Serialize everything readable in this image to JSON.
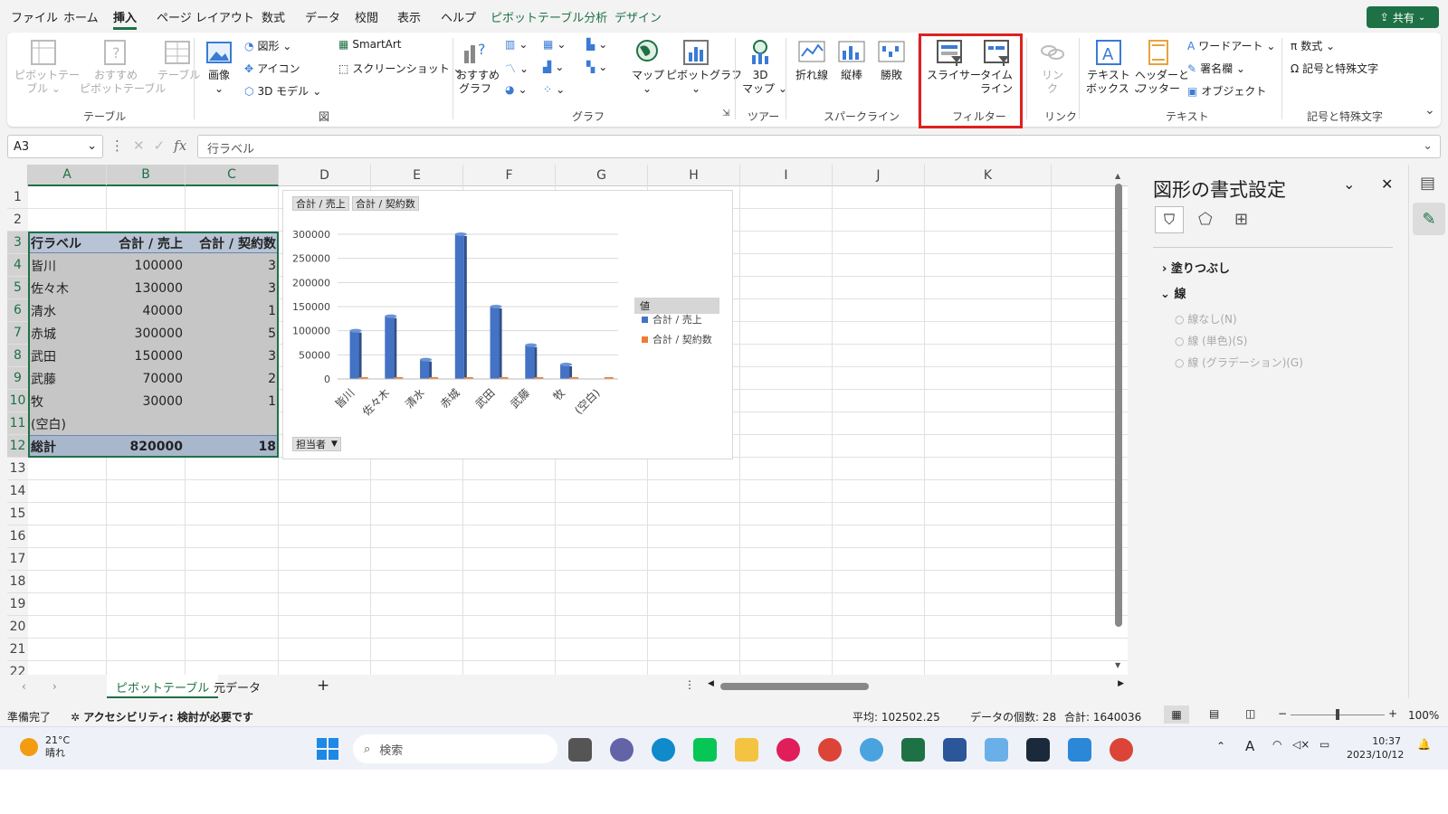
{
  "menu": {
    "tabs": [
      "ファイル",
      "ホーム",
      "挿入",
      "ページ レイアウト",
      "数式",
      "データ",
      "校閲",
      "表示",
      "ヘルプ",
      "ピボットテーブル分析",
      "デザイン"
    ],
    "share": "共有"
  },
  "ribbon": {
    "pivot": "ピボットテー\nブル ⌄",
    "recpivot": "おすすめ\nピボットテーブル",
    "table": "テーブル",
    "grp_table": "テーブル",
    "image": "画像",
    "shapes": "図形 ⌄",
    "icons": "アイコン",
    "model3d": "3D モデル",
    "smartart": "SmartArt",
    "screenshot": "スクリーンショット ⌄",
    "grp_fig": "図",
    "recchart": "おすすめ\nグラフ",
    "map": "マップ",
    "pivotchart": "ピボットグラフ",
    "grp_chart": "グラフ",
    "map3d": "3D\nマップ ⌄",
    "grp_tour": "ツアー",
    "line": "折れ線",
    "column": "縦棒",
    "winloss": "勝敗",
    "grp_spark": "スパークライン",
    "slicer": "スライサー",
    "timeline": "タイム\nライン",
    "grp_filter": "フィルター",
    "link": "リン\nク",
    "grp_link": "リンク",
    "textbox": "テキスト\nボックス ⌄",
    "headerfooter": "ヘッダーと\nフッター",
    "wordart": "ワードアート ⌄",
    "signature": "署名欄 ⌄",
    "object": "オブジェクト",
    "grp_text": "テキスト",
    "equation": "数式 ⌄",
    "symbol": "記号と特殊文字",
    "grp_symbol": "記号と特殊文字"
  },
  "formula": {
    "namebox": "A3",
    "content": "行ラベル",
    "fx": "fx"
  },
  "columns": [
    "A",
    "B",
    "C",
    "D",
    "E",
    "F",
    "G",
    "H",
    "I",
    "J",
    "K"
  ],
  "rows": [
    "1",
    "2",
    "3",
    "4",
    "5",
    "6",
    "7",
    "8",
    "9",
    "10",
    "11",
    "12",
    "13",
    "14",
    "15",
    "16",
    "17",
    "18",
    "19",
    "20",
    "21",
    "22"
  ],
  "pivot": {
    "headers": [
      "行ラベル",
      "合計 / 売上",
      "合計 / 契約数"
    ],
    "data": [
      [
        "皆川",
        "100000",
        "3"
      ],
      [
        "佐々木",
        "130000",
        "3"
      ],
      [
        "清水",
        "40000",
        "1"
      ],
      [
        "赤城",
        "300000",
        "5"
      ],
      [
        "武田",
        "150000",
        "3"
      ],
      [
        "武藤",
        "70000",
        "2"
      ],
      [
        "牧",
        "30000",
        "1"
      ],
      [
        "(空白)",
        "",
        ""
      ]
    ],
    "total": [
      "総計",
      "820000",
      "18"
    ]
  },
  "chart_data": {
    "type": "bar",
    "categories": [
      "皆川",
      "佐々木",
      "清水",
      "赤城",
      "武田",
      "武藤",
      "牧",
      "(空白)"
    ],
    "series": [
      {
        "name": "合計 / 売上",
        "values": [
          100000,
          130000,
          40000,
          300000,
          150000,
          70000,
          30000,
          0
        ],
        "color": "#4472c4"
      },
      {
        "name": "合計 / 契約数",
        "values": [
          3,
          3,
          1,
          5,
          3,
          2,
          1,
          0
        ],
        "color": "#ed7d31"
      }
    ],
    "yticks": [
      "300000",
      "250000",
      "200000",
      "150000",
      "100000",
      "50000",
      "0"
    ],
    "ylim": [
      0,
      300000
    ],
    "legend_title": "値",
    "field_buttons": [
      "合計 / 売上",
      "合計 / 契約数"
    ],
    "axis_button": "担当者"
  },
  "pane": {
    "title": "図形の書式設定",
    "fill": "塗りつぶし",
    "line": "線",
    "opt1": "線なし(N)",
    "opt2": "線 (単色)(S)",
    "opt3": "線 (グラデーション)(G)"
  },
  "sheets": {
    "tab1": "ピボットテーブル",
    "tab2": "元データ",
    "add": "+"
  },
  "status": {
    "ready": "準備完了",
    "access": "アクセシビリティ: 検討が必要です",
    "avg": "平均: 102502.25",
    "count": "データの個数: 28",
    "sum": "合計: 1640036",
    "zoom": "100%"
  },
  "taskbar": {
    "temp": "21°C",
    "weather": "晴れ",
    "search": "検索",
    "time": "10:37",
    "date": "2023/10/12"
  }
}
